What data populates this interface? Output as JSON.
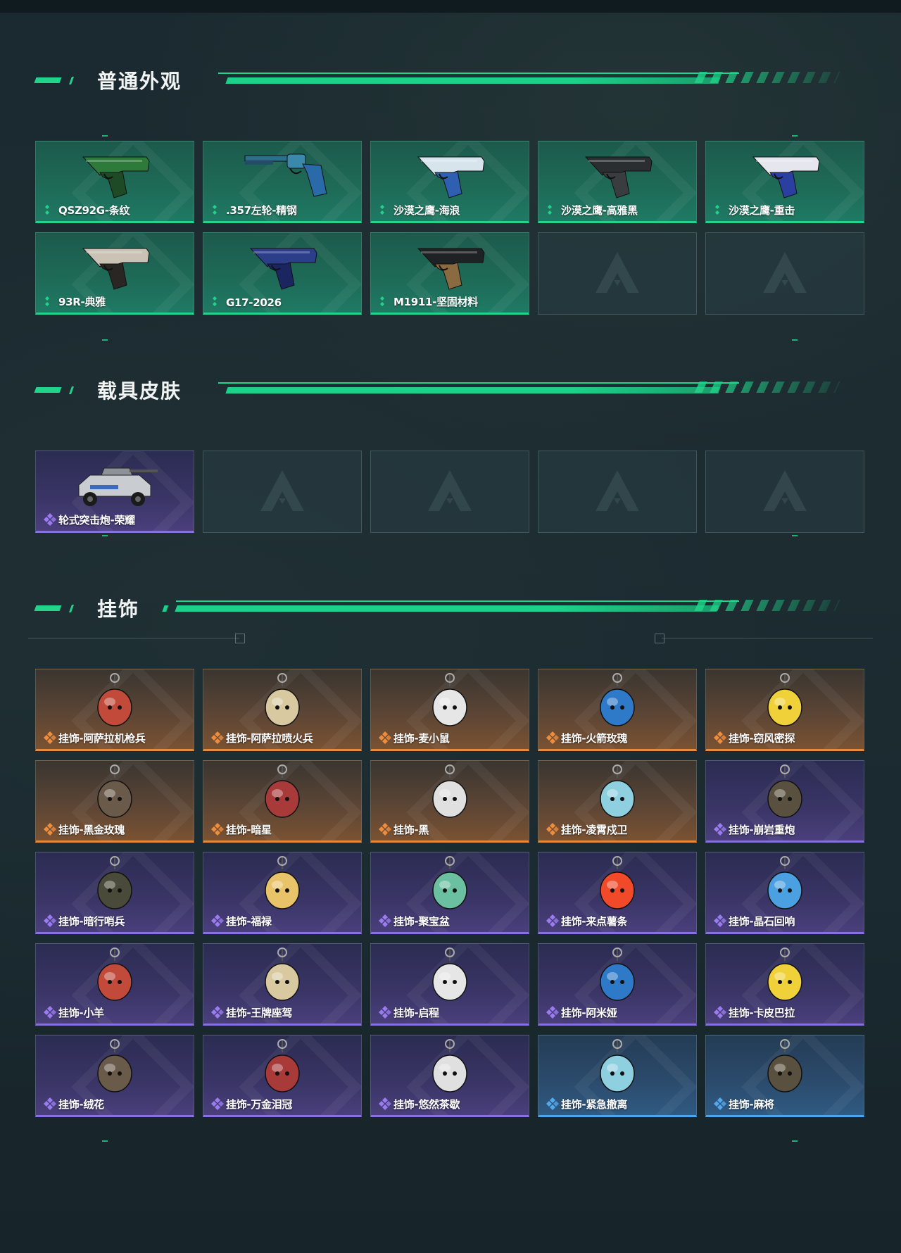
{
  "colors": {
    "accent": "#22d38a",
    "green": "#22d38a",
    "purple": "#8a6fe0",
    "orange": "#e88a3c",
    "blue": "#4fa3e8"
  },
  "sections": [
    {
      "title": "普通外观",
      "items": [
        {
          "label": "QSZ92G-条纹",
          "rarity": "green",
          "icon": "pistol-green-icon"
        },
        {
          "label": ".357左轮-精钢",
          "rarity": "green",
          "icon": "revolver-icon"
        },
        {
          "label": "沙漠之鹰-海浪",
          "rarity": "green",
          "icon": "desert-eagle-wave-icon"
        },
        {
          "label": "沙漠之鹰-高雅黑",
          "rarity": "green",
          "icon": "desert-eagle-black-icon"
        },
        {
          "label": "沙漠之鹰-重击",
          "rarity": "green",
          "icon": "desert-eagle-heavy-icon"
        },
        {
          "label": "93R-典雅",
          "rarity": "green",
          "icon": "pistol-93r-icon"
        },
        {
          "label": "G17-2026",
          "rarity": "green",
          "icon": "pistol-g17-icon"
        },
        {
          "label": "M1911-坚固材料",
          "rarity": "green",
          "icon": "pistol-m1911-icon"
        },
        {
          "label": "",
          "rarity": "empty",
          "icon": "empty-slot-logo-icon"
        },
        {
          "label": "",
          "rarity": "empty",
          "icon": "empty-slot-logo-icon"
        }
      ]
    },
    {
      "title": "载具皮肤",
      "items": [
        {
          "label": "轮式突击炮-荣耀",
          "rarity": "purple",
          "icon": "assault-vehicle-icon"
        },
        {
          "label": "",
          "rarity": "empty",
          "icon": "empty-slot-logo-icon"
        },
        {
          "label": "",
          "rarity": "empty",
          "icon": "empty-slot-logo-icon"
        },
        {
          "label": "",
          "rarity": "empty",
          "icon": "empty-slot-logo-icon"
        },
        {
          "label": "",
          "rarity": "empty",
          "icon": "empty-slot-logo-icon"
        }
      ]
    },
    {
      "title": "挂饰",
      "items": [
        {
          "label": "挂饰-阿萨拉机枪兵",
          "rarity": "orange",
          "icon": "charm-gunner-icon"
        },
        {
          "label": "挂饰-阿萨拉喷火兵",
          "rarity": "orange",
          "icon": "charm-flamer-icon"
        },
        {
          "label": "挂饰-麦小鼠",
          "rarity": "orange",
          "icon": "charm-mouse-icon"
        },
        {
          "label": "挂饰-火箭玫瑰",
          "rarity": "orange",
          "icon": "charm-rocket-rose-icon"
        },
        {
          "label": "挂饰-窃风密探",
          "rarity": "orange",
          "icon": "charm-spy-icon"
        },
        {
          "label": "挂饰-黑金玫瑰",
          "rarity": "orange",
          "icon": "charm-black-gold-rose-icon"
        },
        {
          "label": "挂饰-暗星",
          "rarity": "orange",
          "icon": "charm-dark-star-icon"
        },
        {
          "label": "挂饰-黑",
          "rarity": "orange",
          "icon": "charm-black-icon"
        },
        {
          "label": "挂饰-凌霄戍卫",
          "rarity": "orange",
          "icon": "charm-guard-icon"
        },
        {
          "label": "挂饰-崩岩重炮",
          "rarity": "purple",
          "icon": "charm-cannon-icon"
        },
        {
          "label": "挂饰-暗行哨兵",
          "rarity": "purple",
          "icon": "charm-sentinel-icon"
        },
        {
          "label": "挂饰-福禄",
          "rarity": "purple",
          "icon": "charm-fortune-icon"
        },
        {
          "label": "挂饰-聚宝盆",
          "rarity": "purple",
          "icon": "charm-treasure-bowl-icon"
        },
        {
          "label": "挂饰-来点薯条",
          "rarity": "purple",
          "icon": "charm-fries-icon"
        },
        {
          "label": "挂饰-晶石回响",
          "rarity": "purple",
          "icon": "charm-crystal-icon"
        },
        {
          "label": "挂饰-小羊",
          "rarity": "purple",
          "icon": "charm-lamb-icon"
        },
        {
          "label": "挂饰-王牌座驾",
          "rarity": "purple",
          "icon": "charm-jet-icon"
        },
        {
          "label": "挂饰-启程",
          "rarity": "purple",
          "icon": "charm-departure-icon"
        },
        {
          "label": "挂饰-阿米娅",
          "rarity": "purple",
          "icon": "charm-amiya-icon"
        },
        {
          "label": "挂饰-卡皮巴拉",
          "rarity": "purple",
          "icon": "charm-capybara-icon"
        },
        {
          "label": "挂饰-绒花",
          "rarity": "purple",
          "icon": "charm-velvet-flower-icon"
        },
        {
          "label": "挂饰-万金泪冠",
          "rarity": "purple",
          "icon": "charm-crown-icon"
        },
        {
          "label": "挂饰-悠然茶歇",
          "rarity": "purple",
          "icon": "charm-cupcake-icon"
        },
        {
          "label": "挂饰-紧急撤离",
          "rarity": "blue",
          "icon": "charm-evac-icon"
        },
        {
          "label": "挂饰-麻将",
          "rarity": "blue",
          "icon": "charm-mahjong-icon"
        }
      ]
    }
  ]
}
